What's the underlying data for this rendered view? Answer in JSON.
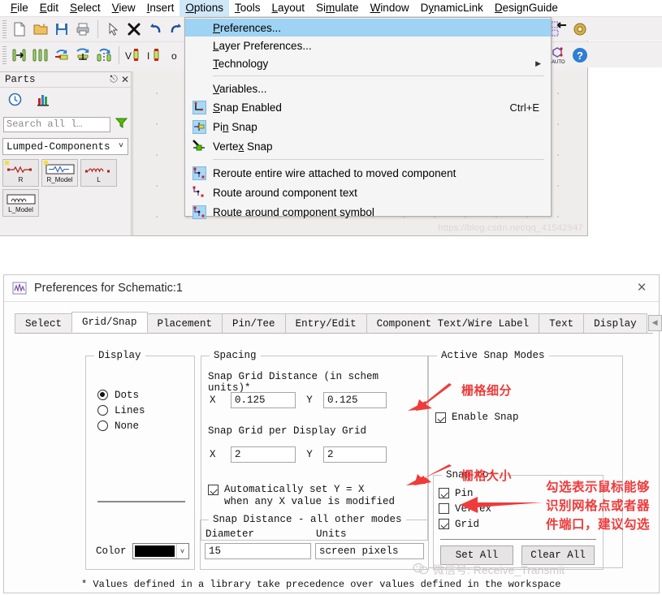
{
  "app": {
    "menubar": [
      {
        "label": "File",
        "mnemonic": "F"
      },
      {
        "label": "Edit",
        "mnemonic": "E"
      },
      {
        "label": "Select",
        "mnemonic": "S"
      },
      {
        "label": "View",
        "mnemonic": "V"
      },
      {
        "label": "Insert",
        "mnemonic": "I"
      },
      {
        "label": "Options",
        "mnemonic": "O"
      },
      {
        "label": "Tools",
        "mnemonic": "T"
      },
      {
        "label": "Layout",
        "mnemonic": "L"
      },
      {
        "label": "Simulate",
        "mnemonic": "m"
      },
      {
        "label": "Window",
        "mnemonic": "W"
      },
      {
        "label": "DynamicLink",
        "mnemonic": "y"
      },
      {
        "label": "DesignGuide",
        "mnemonic": "D"
      }
    ],
    "canvas_watermark": "https://blog.csdn.net/qq_41542947"
  },
  "options_menu": {
    "items": [
      {
        "label": "Preferences...",
        "icon": "none",
        "accel": "",
        "selected": true,
        "separator_after": false
      },
      {
        "label": "Layer Preferences...",
        "icon": "none",
        "accel": "",
        "selected": false,
        "separator_after": false
      },
      {
        "label": "Technology",
        "icon": "none",
        "accel": "",
        "selected": false,
        "submenu": true,
        "separator_after": true
      },
      {
        "label": "Variables...",
        "icon": "none",
        "accel": "",
        "selected": false,
        "separator_after": false
      },
      {
        "label": "Snap Enabled",
        "icon": "snap-enabled-icon",
        "accel": "Ctrl+E",
        "selected": false,
        "separator_after": false
      },
      {
        "label": "Pin Snap",
        "icon": "pin-snap-icon",
        "accel": "",
        "selected": false,
        "separator_after": false
      },
      {
        "label": "Vertex Snap",
        "icon": "vertex-snap-icon",
        "accel": "",
        "selected": false,
        "separator_after": true
      },
      {
        "label": "Reroute entire wire attached to moved component",
        "icon": "reroute-icon",
        "accel": "",
        "selected": false,
        "separator_after": false
      },
      {
        "label": "Route around component text",
        "icon": "route-text-icon",
        "accel": "",
        "selected": false,
        "separator_after": false
      },
      {
        "label": "Route around component symbol",
        "icon": "route-symbol-icon",
        "accel": "",
        "selected": false,
        "separator_after": false
      }
    ]
  },
  "parts_panel": {
    "title": "Parts",
    "search_placeholder": "Search all l…",
    "library": "Lumped-Components",
    "items": [
      {
        "label": "R",
        "boxed": false
      },
      {
        "label": "R_Model",
        "boxed": true
      },
      {
        "label": "L",
        "boxed": false
      },
      {
        "label": "L_Model",
        "boxed": true
      }
    ]
  },
  "dialog": {
    "title": "Preferences for Schematic:1",
    "close_label": "×",
    "tabs": [
      {
        "label": "Select",
        "active": false
      },
      {
        "label": "Grid/Snap",
        "active": true
      },
      {
        "label": "Placement",
        "active": false
      },
      {
        "label": "Pin/Tee",
        "active": false
      },
      {
        "label": "Entry/Edit",
        "active": false
      },
      {
        "label": "Component Text/Wire Label",
        "active": false
      },
      {
        "label": "Text",
        "active": false
      },
      {
        "label": "Display",
        "active": false
      }
    ],
    "tab_nav": {
      "prev": "◀",
      "next": "▶"
    },
    "display_group": {
      "legend": "Display",
      "options": [
        {
          "label": "Dots",
          "selected": true
        },
        {
          "label": "Lines",
          "selected": false
        },
        {
          "label": "None",
          "selected": false
        }
      ],
      "color_label": "Color",
      "color_value": "#000000"
    },
    "spacing_group": {
      "legend": "Spacing",
      "snap_grid_distance_label": "Snap Grid Distance (in schem units)*",
      "snap_grid_distance": {
        "x_label": "X",
        "x_value": "0.125",
        "y_label": "Y",
        "y_value": "0.125"
      },
      "snap_per_display_label": "Snap Grid per Display Grid",
      "snap_per_display": {
        "x_label": "X",
        "x_value": "2",
        "y_label": "Y",
        "y_value": "2"
      },
      "auto_checkbox": {
        "checked": true,
        "line1": "Automatically set Y = X",
        "line2": "when any X value is modified"
      }
    },
    "snap_distance_group": {
      "legend": "Snap Distance - all other modes",
      "diameter_label": "Diameter",
      "diameter_value": "15",
      "units_label": "Units",
      "units_value": "screen pixels"
    },
    "active_snap_group": {
      "legend": "Active Snap Modes",
      "enable_snap": {
        "label": "Enable Snap",
        "checked": true
      },
      "snap_to_legend": "Snap to:",
      "snap_to": [
        {
          "label": "Pin",
          "checked": true
        },
        {
          "label": "Vertex",
          "checked": false
        },
        {
          "label": "Grid",
          "checked": true
        }
      ],
      "set_all": "Set All",
      "clear_all": "Clear All"
    },
    "footnote": "* Values defined in a library take precedence over values defined in the workspace"
  },
  "annotations": {
    "color": "#ef3b3b",
    "items": [
      {
        "text": "栅格细分",
        "name": "annotation-grid-subdivision"
      },
      {
        "text": "栅格大小",
        "name": "annotation-grid-size"
      },
      {
        "text": "勾选表示鼠标能够",
        "name": "annotation-snapto-line1"
      },
      {
        "text": "识别网格点或者器",
        "name": "annotation-snapto-line2"
      },
      {
        "text": "件端口，建议勾选",
        "name": "annotation-snapto-line3"
      }
    ]
  },
  "watermark": {
    "wechat": "微信号: Receive_Transmit"
  }
}
